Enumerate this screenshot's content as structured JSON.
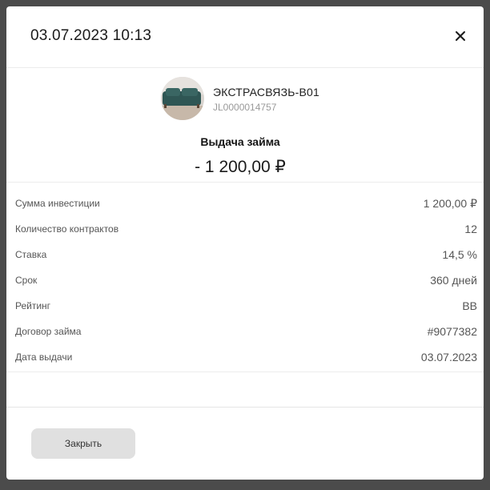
{
  "modal": {
    "title": "03.07.2023 10:13",
    "close_icon": "close-icon"
  },
  "summary": {
    "company_name": "ЭКСТРАСВЯЗЬ-В01",
    "company_id": "JL0000014757",
    "operation": "Выдача займа",
    "amount": "- 1 200,00 ₽"
  },
  "details": [
    {
      "label": "Сумма инвестиции",
      "value": "1 200,00 ₽"
    },
    {
      "label": "Количество контрактов",
      "value": "12"
    },
    {
      "label": "Ставка",
      "value": "14,5 %"
    },
    {
      "label": "Срок",
      "value": "360 дней"
    },
    {
      "label": "Рейтинг",
      "value": "BB"
    },
    {
      "label": "Договор займа",
      "value": "#9077382"
    },
    {
      "label": "Дата выдачи",
      "value": "03.07.2023"
    }
  ],
  "footer": {
    "close_label": "Закрыть"
  },
  "colors": {
    "backdrop": "#4b4b4b",
    "surface": "#ffffff",
    "button_bg": "#e0e0e0",
    "divider": "#ececec"
  }
}
